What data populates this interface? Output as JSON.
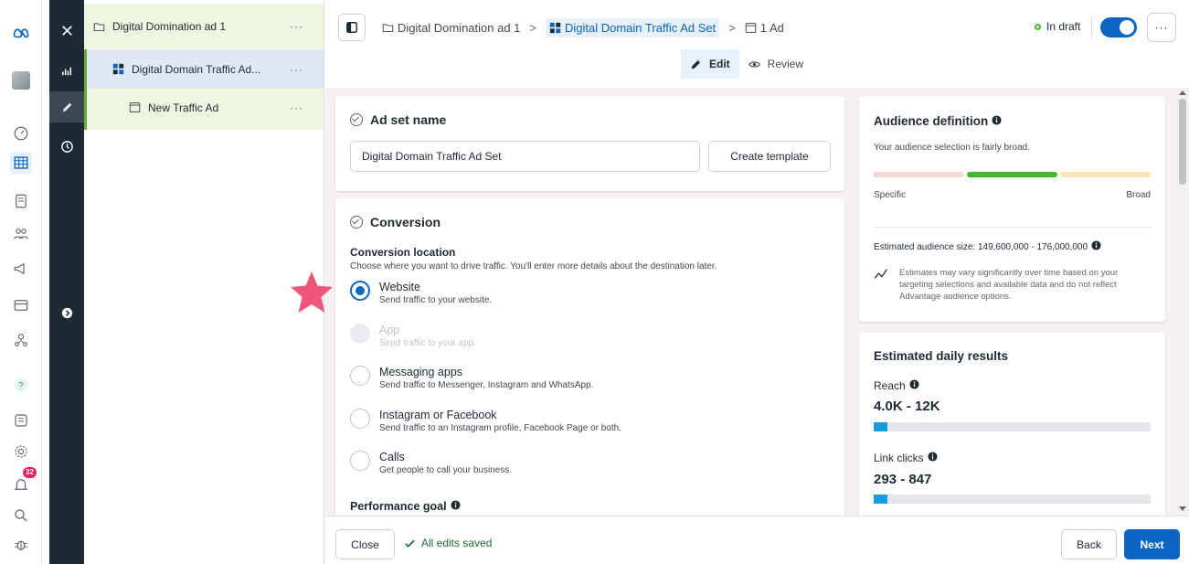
{
  "rail": {
    "notification_count": "32",
    "icons": [
      "meta-logo-icon",
      "profile-thumbnail",
      "dashboard-icon",
      "table-icon",
      "pages-icon",
      "audience-icon",
      "campaign-icon",
      "billing-icon",
      "business-icon",
      "help-icon",
      "notebook-icon",
      "settings-icon",
      "notifications-icon",
      "search-icon",
      "bug-icon"
    ]
  },
  "tree": {
    "campaign": "Digital Domination ad 1",
    "adset": "Digital Domain Traffic Ad...",
    "ad": "New Traffic Ad",
    "more": "···"
  },
  "header": {
    "crumb_campaign": "Digital Domination ad 1",
    "crumb_adset": "Digital Domain Traffic Ad Set",
    "crumb_ad": "1 Ad",
    "separator": ">",
    "status": "In draft",
    "more": "···",
    "tab_edit": "Edit",
    "tab_review": "Review"
  },
  "adset_card": {
    "title": "Ad set name",
    "name_value": "Digital Domain Traffic Ad Set",
    "create_template": "Create template"
  },
  "conversion": {
    "title": "Conversion",
    "location_label": "Conversion location",
    "location_help": "Choose where you want to drive traffic. You'll enter more details about the destination later.",
    "options": [
      {
        "title": "Website",
        "desc": "Send traffic to your website.",
        "selected": true
      },
      {
        "title": "App",
        "desc": "Send traffic to your app.",
        "disabled": true
      },
      {
        "title": "Messaging apps",
        "desc": "Send traffic to Messenger, Instagram and WhatsApp."
      },
      {
        "title": "Instagram or Facebook",
        "desc": "Send traffic to an Instagram profile, Facebook Page or both."
      },
      {
        "title": "Calls",
        "desc": "Get people to call your business."
      }
    ],
    "performance_goal": "Performance goal"
  },
  "audience": {
    "title": "Audience definition",
    "subtitle": "Your audience selection is fairly broad.",
    "specific": "Specific",
    "broad": "Broad",
    "size": "Estimated audience size: 149,600,000 - 176,000,000",
    "note": "Estimates may vary significantly over time based on your targeting selections and available data and do not reflect Advantage audience options.",
    "colors": {
      "specific": "#f4d6d3",
      "middle": "#42b72a",
      "broad": "#f8e6b8"
    }
  },
  "daily": {
    "title": "Estimated daily results",
    "reach_label": "Reach",
    "reach_value": "4.0K - 12K",
    "reach_fill": 0.05,
    "clicks_label": "Link clicks",
    "clicks_value": "293 - 847",
    "clicks_fill": 0.05
  },
  "footer": {
    "close": "Close",
    "saved": "All edits saved",
    "back": "Back",
    "next": "Next"
  },
  "colors": {
    "accent": "#0a66c2",
    "star": "#f0567a",
    "dark": "#1c2b33"
  }
}
